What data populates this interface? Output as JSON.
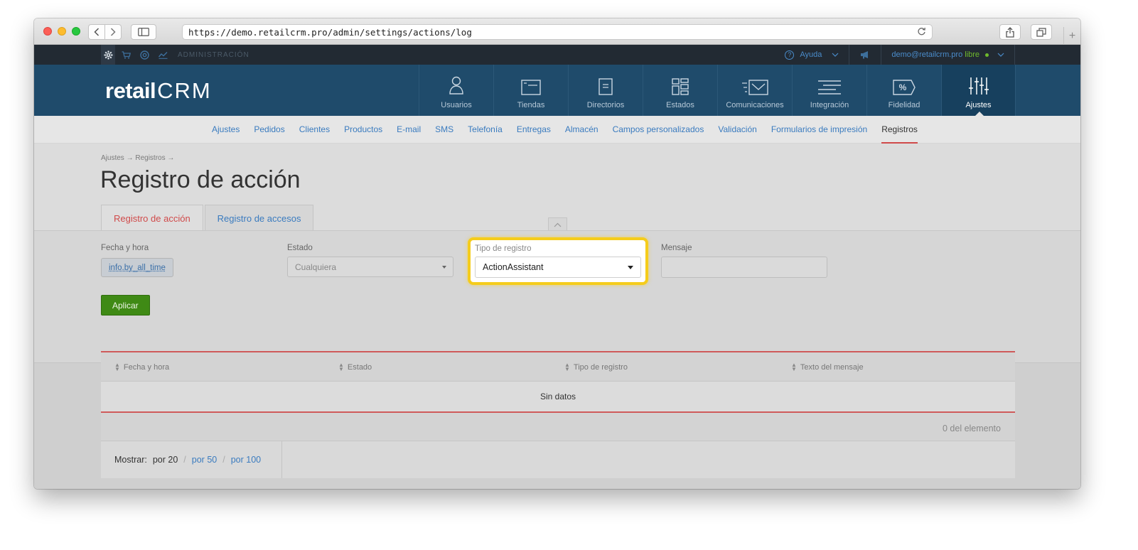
{
  "browser": {
    "url": "https://demo.retailcrm.pro/admin/settings/actions/log"
  },
  "admin_bar": {
    "label": "ADMINISTRACIÓN",
    "help": "Ayuda",
    "user_email": "demo@retailcrm.pro",
    "user_status": "libre"
  },
  "logo": {
    "retail": "retail",
    "crm": "CRM"
  },
  "main_nav": [
    {
      "label": "Usuarios",
      "icon": "user-icon"
    },
    {
      "label": "Tiendas",
      "icon": "store-icon"
    },
    {
      "label": "Directorios",
      "icon": "document-icon"
    },
    {
      "label": "Estados",
      "icon": "grid-icon"
    },
    {
      "label": "Comunicaciones",
      "icon": "envelope-icon"
    },
    {
      "label": "Integración",
      "icon": "lines-icon"
    },
    {
      "label": "Fidelidad",
      "icon": "percent-tag-icon"
    },
    {
      "label": "Ajustes",
      "icon": "sliders-icon",
      "active": true
    }
  ],
  "sub_nav": [
    "Ajustes",
    "Pedidos",
    "Clientes",
    "Productos",
    "E-mail",
    "SMS",
    "Telefonía",
    "Entregas",
    "Almacén",
    "Campos personalizados",
    "Validación",
    "Formularios de impresión",
    "Registros"
  ],
  "page": {
    "breadcrumb": "Ajustes → Registros →",
    "title": "Registro de acción"
  },
  "tabs": [
    "Registro de acción",
    "Registro de accesos"
  ],
  "filters": {
    "date_label": "Fecha y hora",
    "date_value": "info.by_all_time",
    "status_label": "Estado",
    "status_value": "Cualquiera",
    "type_label": "Tipo de registro",
    "type_value": "ActionAssistant",
    "message_label": "Mensaje",
    "message_value": "",
    "apply_label": "Aplicar"
  },
  "table": {
    "columns": [
      "Fecha y hora",
      "Estado",
      "Tipo de registro",
      "Texto del mensaje"
    ],
    "empty": "Sin datos",
    "count": "0 del elemento"
  },
  "pager": {
    "label": "Mostrar:",
    "current": "por 20",
    "options": [
      "por 50",
      "por 100"
    ]
  },
  "colors": {
    "nav_bg": "#1f4b6b",
    "accent_red": "#d04a4a",
    "link_blue": "#3a7bbf",
    "apply_green": "#3f8a15",
    "highlight_yellow": "#f5cc1b"
  }
}
